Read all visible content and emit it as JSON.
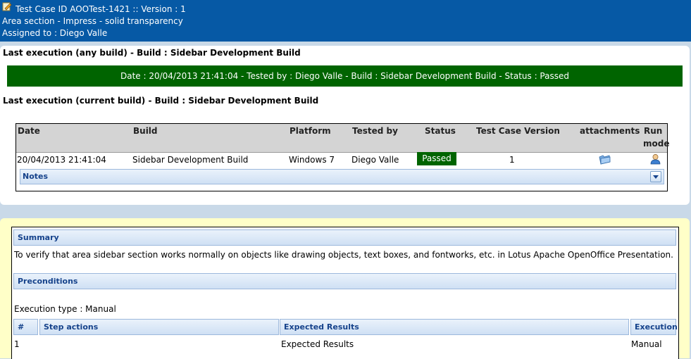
{
  "header": {
    "title": "Test Case ID AOOTest-1421 :: Version : 1",
    "area": "Area section - Impress - solid transparency",
    "assigned": "Assigned to : Diego Valle"
  },
  "last_any": "Last execution (any build) - Build : Sidebar Development Build",
  "status_line": "Date : 20/04/2013 21:41:04 - Tested by : Diego Valle - Build : Sidebar Development Build - Status : Passed",
  "last_current": "Last execution (current build) - Build : Sidebar Development Build",
  "exec_table": {
    "headers": [
      "Date",
      "Build",
      "Platform",
      "Tested by",
      "Status",
      "Test Case Version",
      "attachments",
      "Run",
      "mode"
    ],
    "row": {
      "date": "20/04/2013 21:41:04",
      "build": "Sidebar Development Build",
      "platform": "Windows 7",
      "tester": "Diego Valle",
      "status": "Passed",
      "version": "1"
    },
    "notes_label": "Notes"
  },
  "spec": {
    "summary_label": "Summary",
    "summary_text": "To verify that area sidebar section works normally on objects like drawing objects, text boxes, and fontworks, etc. in Lotus Apache OpenOffice Presentation.",
    "preconditions_label": "Preconditions",
    "execution_type": "Execution type : Manual",
    "steps_headers": [
      "#",
      "Step actions",
      "Expected Results",
      "Execution"
    ],
    "step": {
      "num": "1",
      "expected": "Expected Results",
      "execution": "Manual"
    }
  },
  "colors": {
    "header_bg": "#0659a5",
    "passed": "#006400",
    "spec_bg": "#ffffc8"
  }
}
